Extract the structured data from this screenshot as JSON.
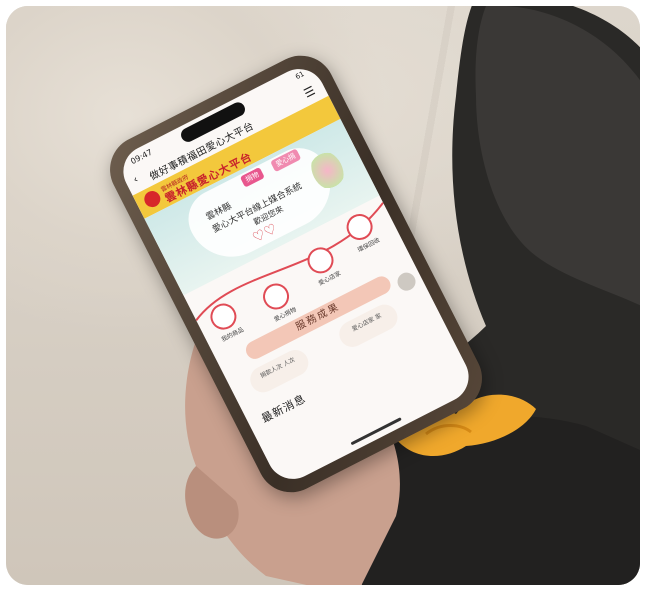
{
  "phone_screen": {
    "status_time": "09:47",
    "status_battery": "61",
    "nav_title": "做好事積福田愛心大平台",
    "brand_subtitle": "雲林縣政府",
    "brand_name": "雲林縣愛心大平台",
    "hero_tag1": "捐物",
    "hero_tag2": "愛心捐",
    "hero_line1": "雲林縣",
    "hero_line2": "愛心大平台線上媒合系統",
    "hero_line3": "歡迎您來",
    "icon_labels": [
      "我的商品",
      "愛心捐物",
      "愛心店家",
      "環保回收"
    ],
    "main_button": "服務成果",
    "pill_left": "捐款人次 人次",
    "pill_right": "愛心店家 家",
    "news_heading": "最新消息"
  },
  "colors": {
    "brand_yellow": "#f3c83c",
    "brand_red": "#c8232b",
    "hero_teal": "#cfe9e8",
    "button_peach": "#f3c7b7"
  }
}
